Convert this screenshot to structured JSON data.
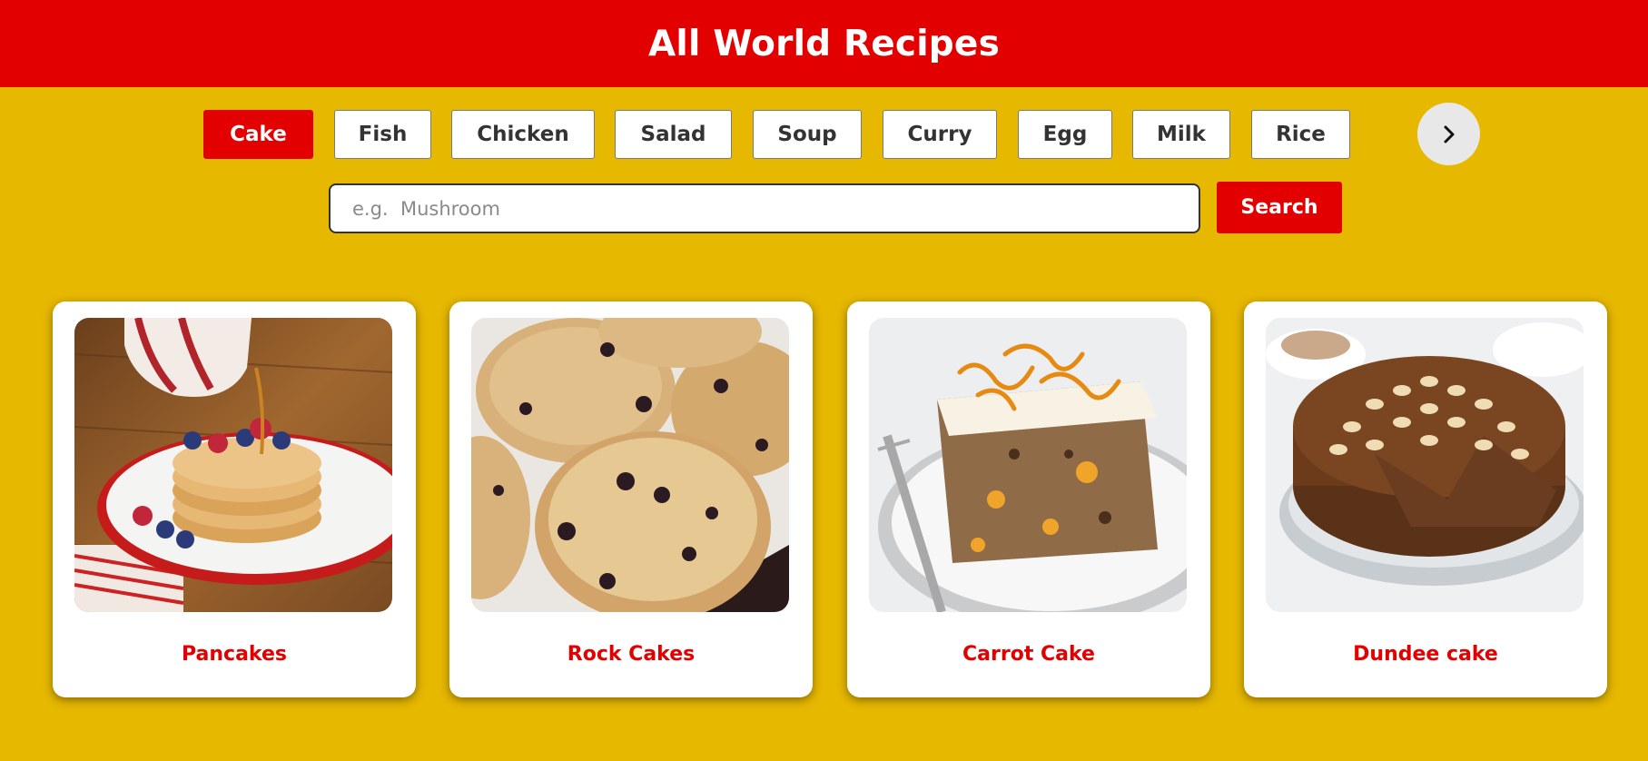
{
  "header": {
    "title": "All World Recipes"
  },
  "categories": [
    {
      "label": "Cake",
      "active": true
    },
    {
      "label": "Fish",
      "active": false
    },
    {
      "label": "Chicken",
      "active": false
    },
    {
      "label": "Salad",
      "active": false
    },
    {
      "label": "Soup",
      "active": false
    },
    {
      "label": "Curry",
      "active": false
    },
    {
      "label": "Egg",
      "active": false
    },
    {
      "label": "Milk",
      "active": false
    },
    {
      "label": "Rice",
      "active": false
    }
  ],
  "next_icon": "chevron-right-icon",
  "search": {
    "placeholder": "e.g.  Mushroom",
    "value": "",
    "button_label": "Search"
  },
  "recipes": [
    {
      "title": "Pancakes",
      "image": "pancakes-photo"
    },
    {
      "title": "Rock Cakes",
      "image": "rock-cakes-photo"
    },
    {
      "title": "Carrot Cake",
      "image": "carrot-cake-photo"
    },
    {
      "title": "Dundee cake",
      "image": "dundee-cake-photo"
    }
  ],
  "colors": {
    "background": "#e6b800",
    "accent": "#e30000",
    "card": "#ffffff"
  }
}
